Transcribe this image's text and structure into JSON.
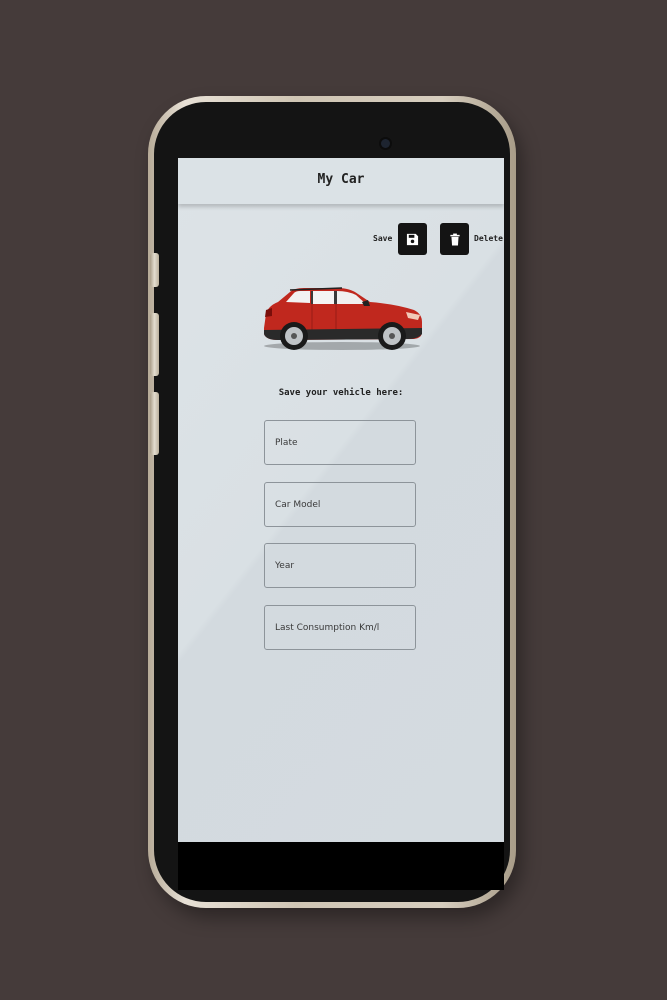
{
  "app": {
    "title": "My Car",
    "actions": {
      "save_label": "Save",
      "delete_label": "Delete",
      "save_icon": "floppy-disk-icon",
      "delete_icon": "trash-icon"
    },
    "car_image": "red-suv-illustration",
    "subtitle": "Save your vehicle here:",
    "fields": {
      "plate": {
        "placeholder": "Plate",
        "value": ""
      },
      "car_model": {
        "placeholder": "Car Model",
        "value": ""
      },
      "year": {
        "placeholder": "Year",
        "value": ""
      },
      "consumption": {
        "placeholder": "Last Consumption Km/l",
        "value": ""
      }
    }
  },
  "colors": {
    "background": "#453b3a",
    "screen": "#d9e0e4",
    "button": "#141414",
    "car": "#c0281e"
  }
}
